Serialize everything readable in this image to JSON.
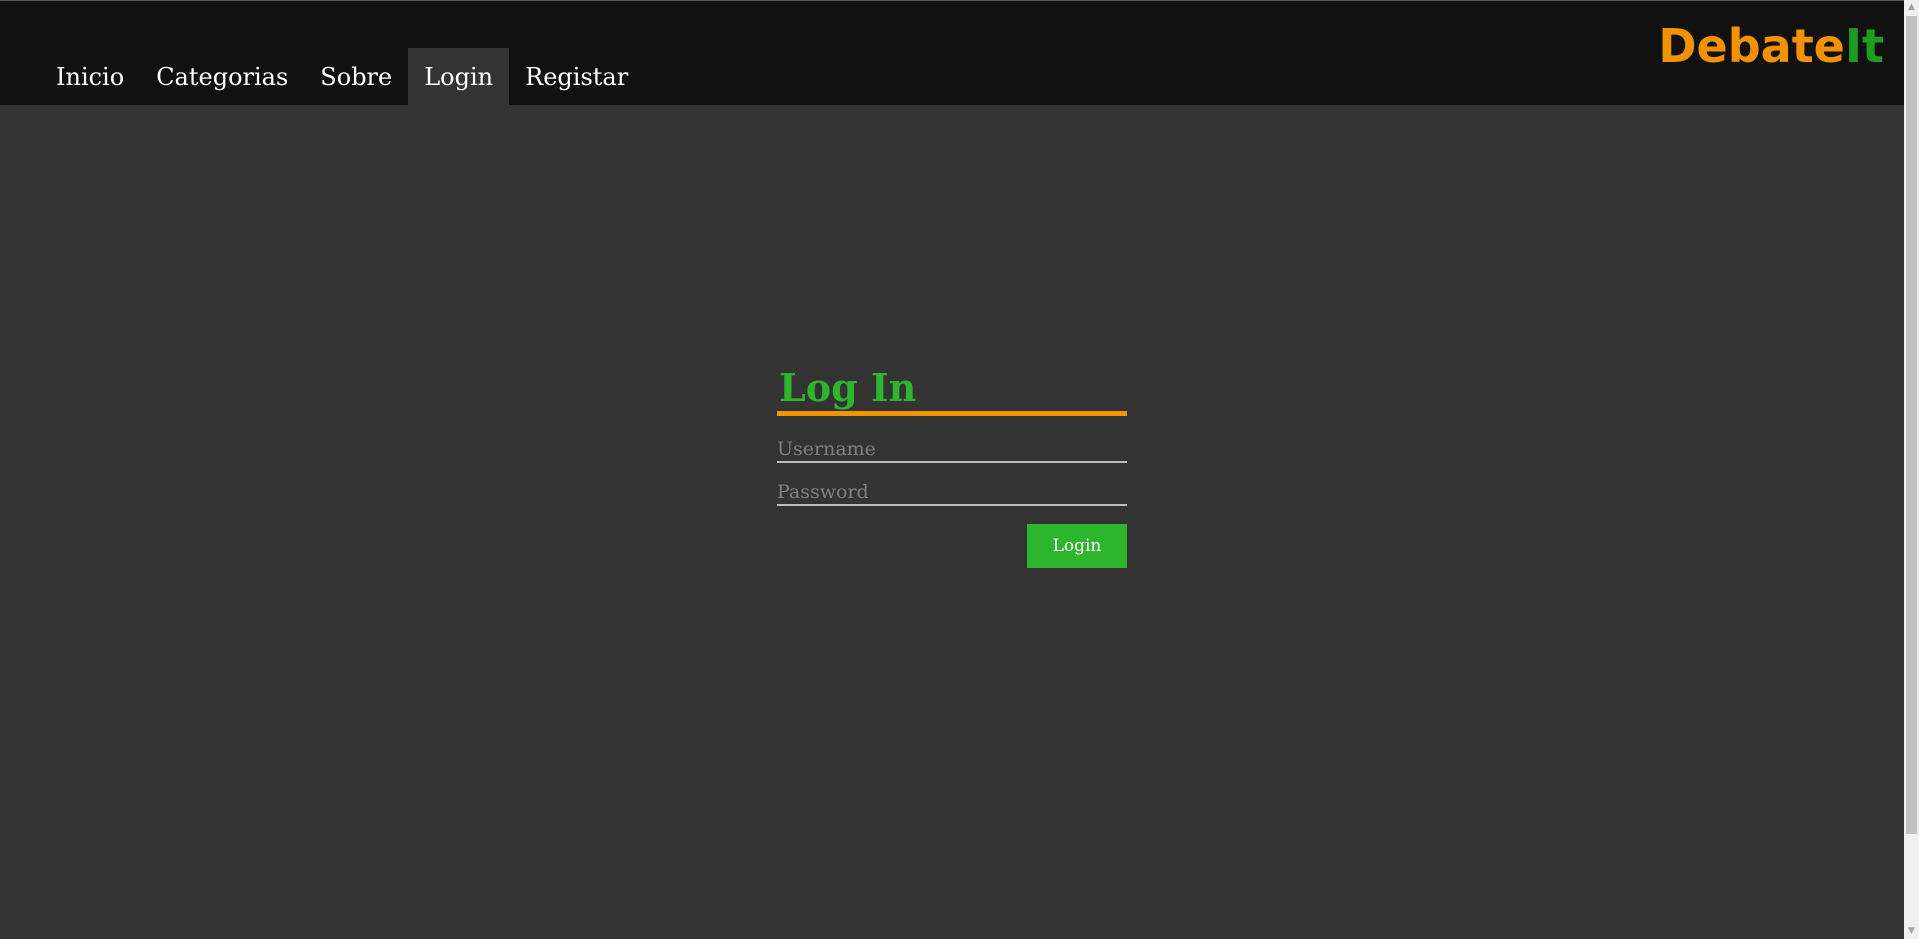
{
  "nav": {
    "items": [
      {
        "label": "Inicio"
      },
      {
        "label": "Categorias"
      },
      {
        "label": "Sobre"
      },
      {
        "label": "Login",
        "active": true
      },
      {
        "label": "Registar"
      }
    ]
  },
  "logo": {
    "part1": "Debate",
    "part2": "It",
    "color1": "#f39200",
    "color2": "#1e9e1e"
  },
  "login": {
    "title": "Log In",
    "username_placeholder": "Username",
    "username_value": "",
    "password_placeholder": "Password",
    "password_value": "",
    "button_label": "Login"
  },
  "scrollbar": {
    "up_icon": "arrow-up-icon",
    "down_icon": "arrow-down-icon"
  },
  "colors": {
    "accent_green": "#2db52d",
    "accent_orange": "#f39200",
    "header_bg": "#111111",
    "page_bg": "#333333"
  }
}
